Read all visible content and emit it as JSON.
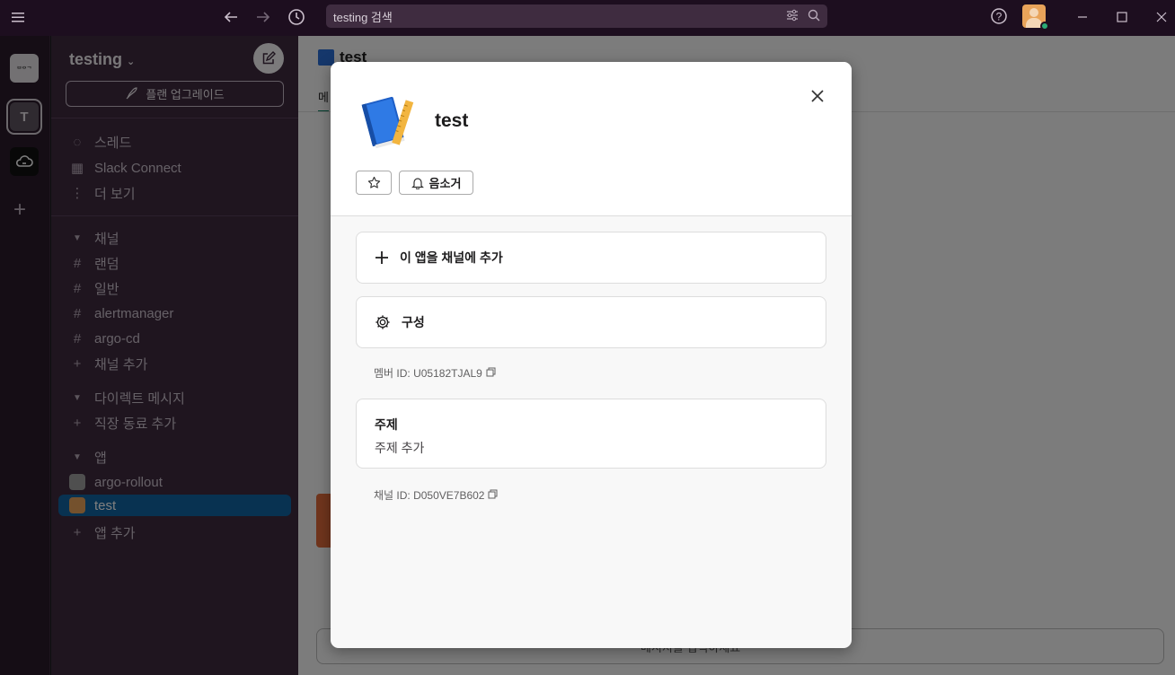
{
  "topbar": {
    "search_text": "testing 검색",
    "icons": [
      "hamburger-icon",
      "back-arrow-icon",
      "forward-arrow-icon",
      "history-icon",
      "filter-icon",
      "search-icon",
      "help-icon",
      "minimize-icon",
      "maximize-icon",
      "close-icon"
    ]
  },
  "rail": {
    "workspaces": [
      {
        "label": "ᄇᄋᄀ"
      },
      {
        "label": "T"
      },
      {
        "label": "cloud"
      }
    ]
  },
  "sidebar": {
    "workspace_name": "testing",
    "upgrade_label": "플랜 업그레이드",
    "top_items": [
      {
        "label": "스레드",
        "icon": "threads-icon"
      },
      {
        "label": "Slack Connect",
        "icon": "building-icon"
      },
      {
        "label": "더 보기",
        "icon": "more-icon"
      }
    ],
    "channels_header": "채널",
    "channels": [
      "랜덤",
      "일반",
      "alertmanager",
      "argo-cd"
    ],
    "add_channel": "채널 추가",
    "dm_header": "다이렉트 메시지",
    "add_coworker": "직장 동료 추가",
    "apps_header": "앱",
    "apps": [
      "argo-rollout",
      "test"
    ],
    "add_app": "앱 추가"
  },
  "main": {
    "channel_title": "test",
    "tab_label": "메",
    "input_hint": "메시지를 입력하세요"
  },
  "modal": {
    "app_name": "test",
    "mute_label": "음소거",
    "add_to_channel_label": "이 앱을 채널에 추가",
    "configure_label": "구성",
    "member_id_text": "멤버 ID: U05182TJAL9",
    "topic_label": "주제",
    "topic_value": "주제 추가",
    "channel_id_text": "채널 ID: D050VE7B602"
  },
  "colors": {
    "topbar": "#1d0e1f",
    "sidebar": "#3e2a3f",
    "active_item": "#1164a3",
    "presence": "#2bac76"
  }
}
